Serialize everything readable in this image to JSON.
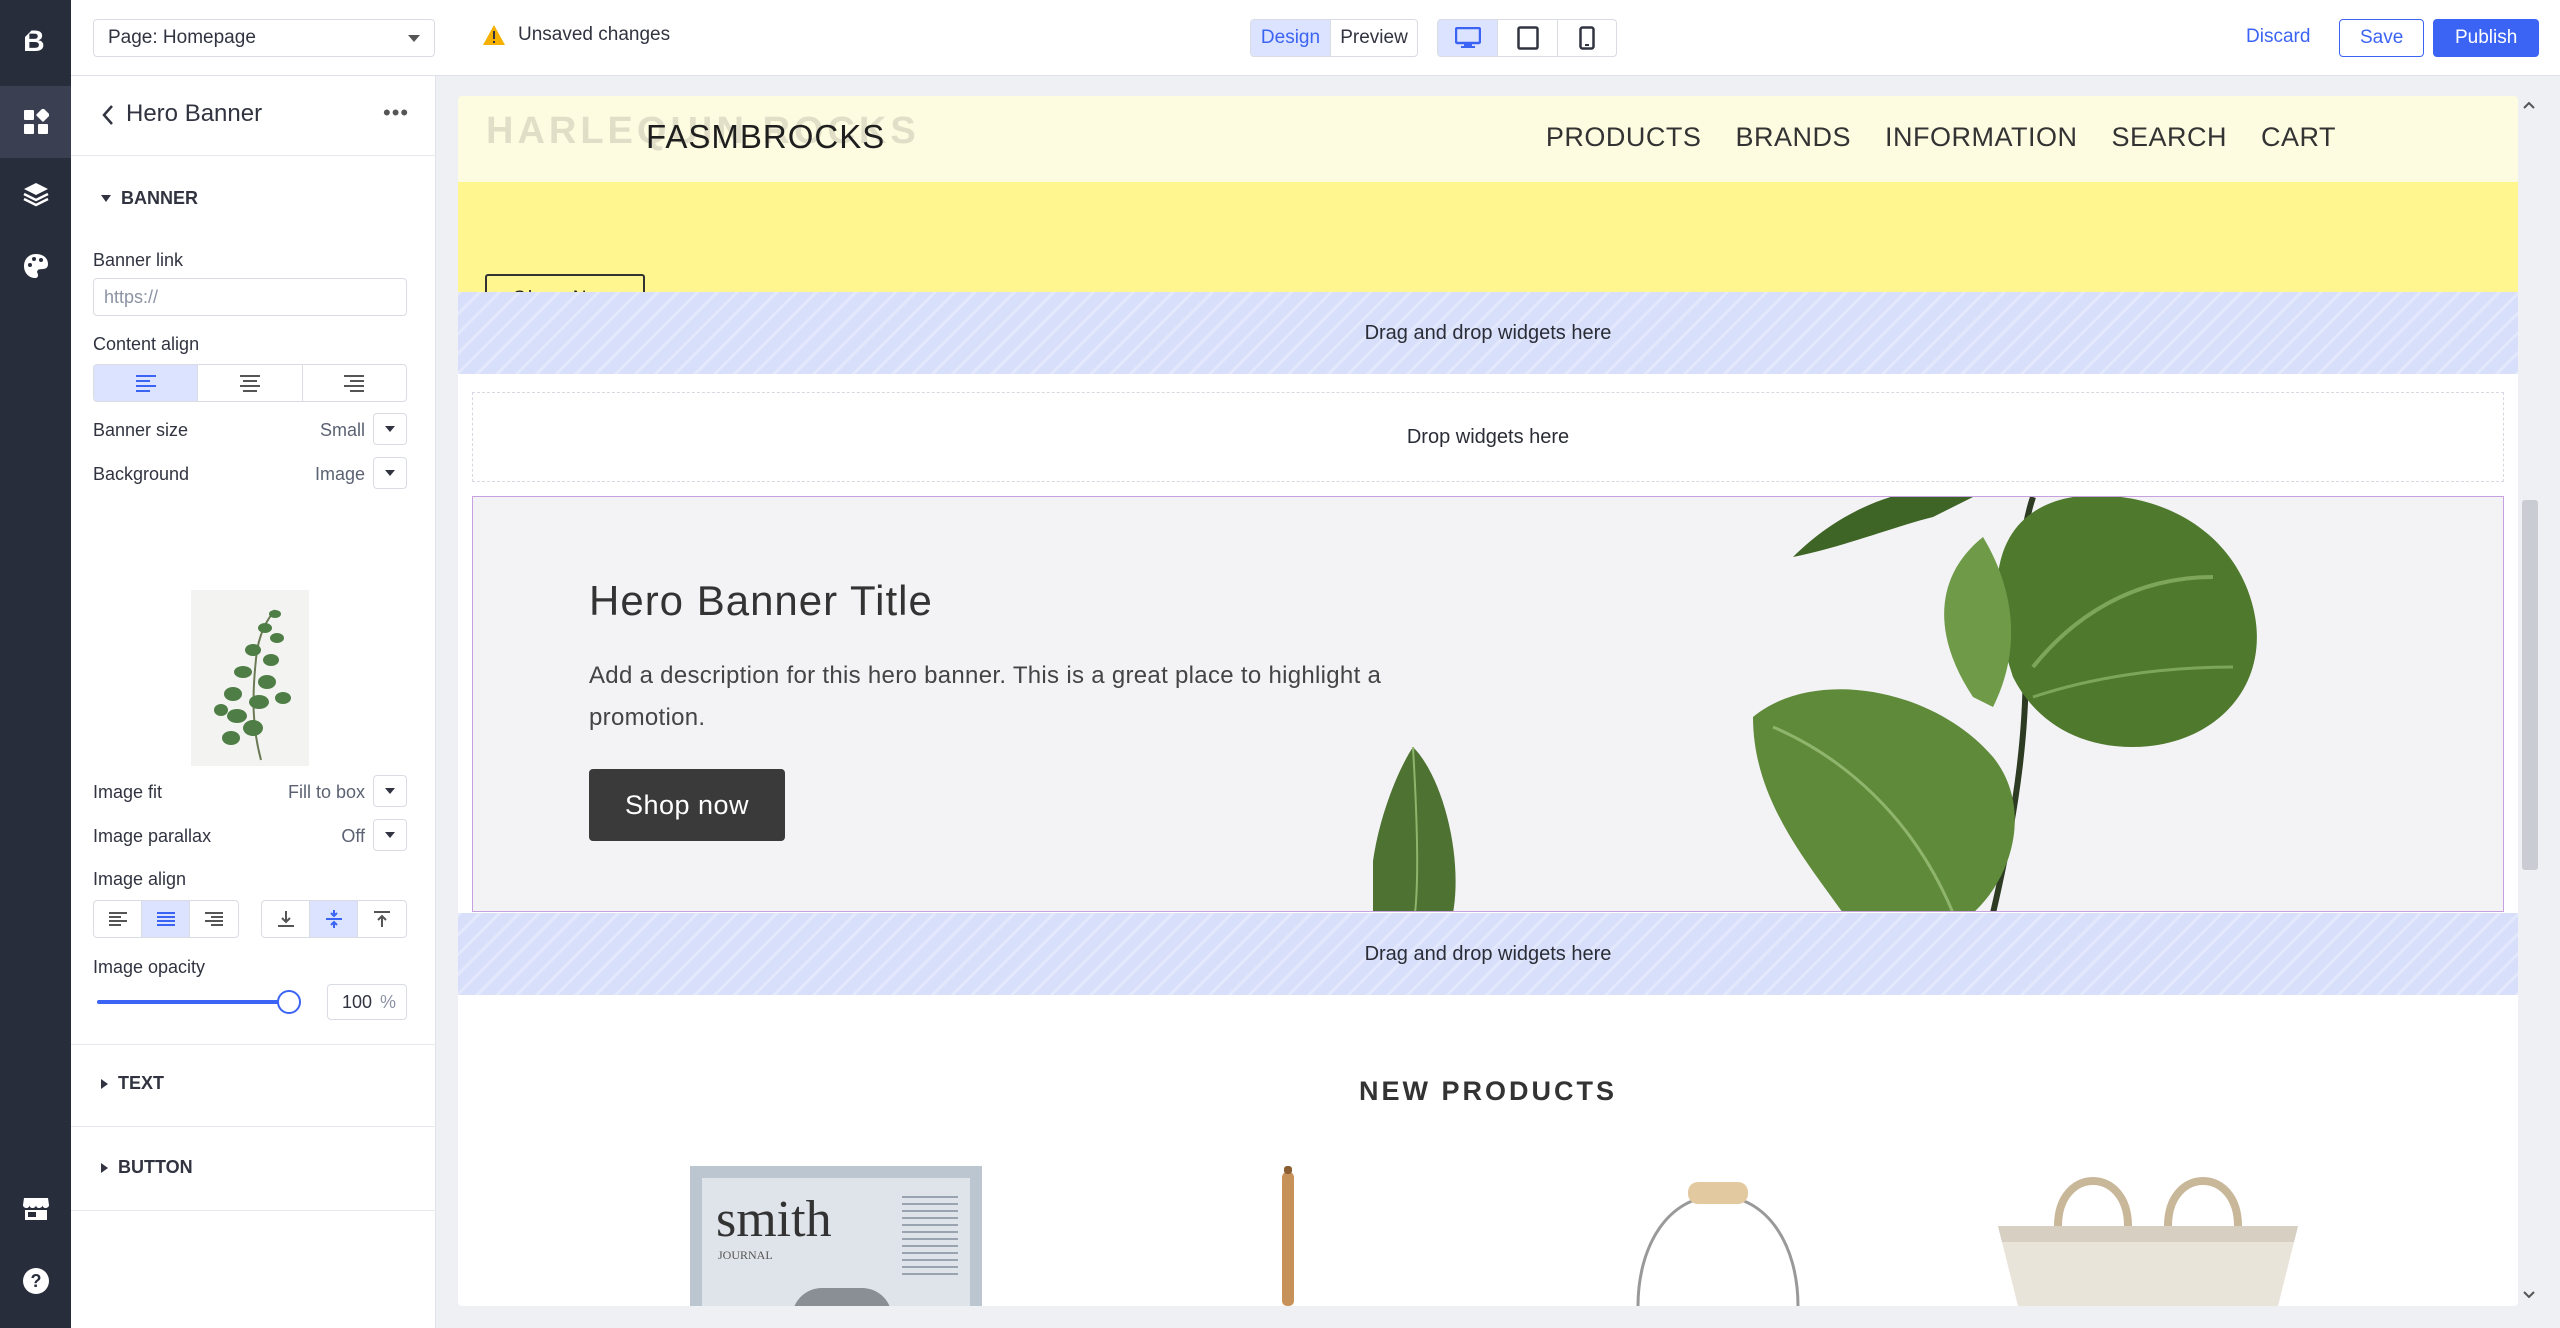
{
  "topbar": {
    "page_select": "Page: Homepage",
    "unsaved": "Unsaved changes",
    "mode_design": "Design",
    "mode_preview": "Preview",
    "discard": "Discard",
    "save": "Save",
    "publish": "Publish",
    "device_icons": [
      "desktop-icon",
      "tablet-icon",
      "mobile-icon"
    ],
    "active_device": "desktop"
  },
  "panel": {
    "title": "Hero Banner",
    "banner_section": "BANNER",
    "banner_link_label": "Banner link",
    "banner_link_placeholder": "https://",
    "content_align_label": "Content align",
    "banner_size_label": "Banner size",
    "banner_size_value": "Small",
    "background_label": "Background",
    "background_value": "Image",
    "image_fit_label": "Image fit",
    "image_fit_value": "Fill to box",
    "image_parallax_label": "Image parallax",
    "image_parallax_value": "Off",
    "image_align_label": "Image align",
    "image_opacity_label": "Image opacity",
    "image_opacity_value": "100",
    "image_opacity_unit": "%",
    "text_section": "TEXT",
    "button_section": "BUTTON"
  },
  "preview": {
    "ghost_logo": "HARLEQUIN ROCKS",
    "logo": "FASMBROCKS",
    "nav": [
      "PRODUCTS",
      "BRANDS",
      "INFORMATION",
      "SEARCH",
      "CART"
    ],
    "shop_now_small": "Shop Now",
    "dropzone_top": "Drag and drop widgets here",
    "dropzone_inner": "Drop widgets here",
    "hero_title": "Hero Banner Title",
    "hero_desc": "Add a description for this hero banner. This is a great place to highlight a promotion.",
    "hero_button": "Shop now",
    "dropzone_bottom": "Drag and drop widgets here",
    "new_products": "NEW PRODUCTS",
    "magazine_title": "smith",
    "magazine_sub": "JOURNAL"
  },
  "colors": {
    "accent": "#3c64f4",
    "rail": "#282d3c",
    "header_bg": "#fdfbe0",
    "yellow_band": "#fff68f",
    "dropzone": "#d8dffb"
  }
}
